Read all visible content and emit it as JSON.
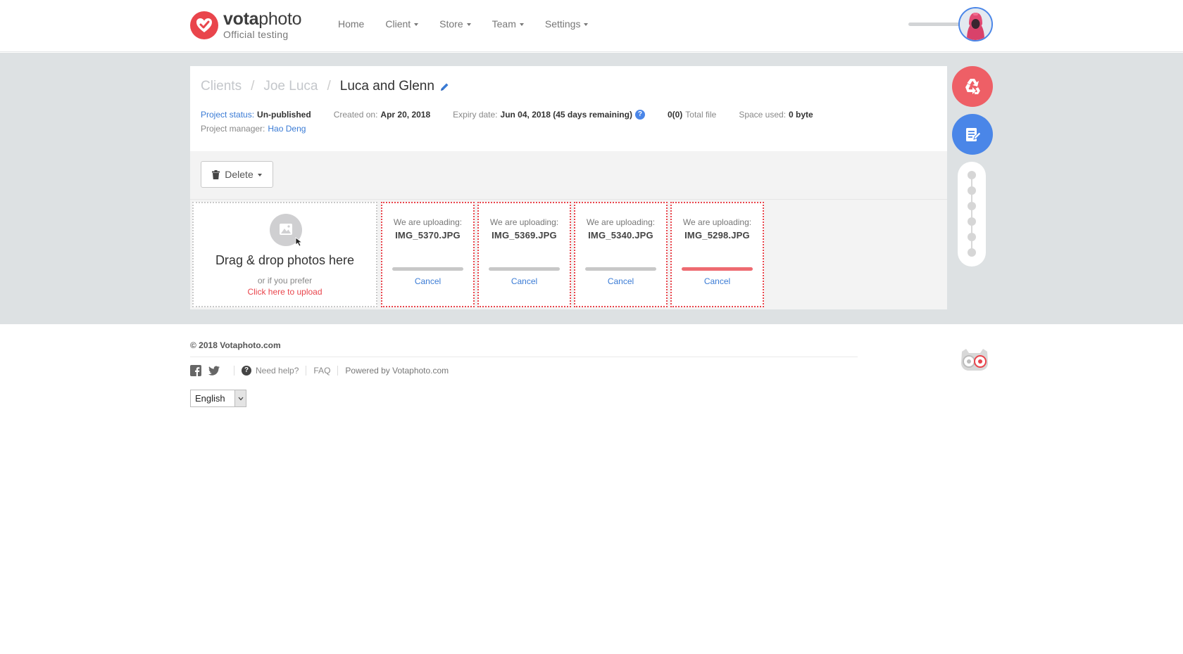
{
  "brand": {
    "name_bold": "vota",
    "name_light": "photo",
    "subtitle": "Official testing",
    "accent": "#e9454c"
  },
  "nav": [
    {
      "label": "Home",
      "dropdown": false
    },
    {
      "label": "Client",
      "dropdown": true
    },
    {
      "label": "Store",
      "dropdown": true
    },
    {
      "label": "Team",
      "dropdown": true
    },
    {
      "label": "Settings",
      "dropdown": true
    }
  ],
  "breadcrumb": {
    "root": "Clients",
    "client": "Joe Luca",
    "project": "Luca and Glenn"
  },
  "meta": {
    "status_label": "Project status:",
    "status_value": "Un-published",
    "created_label": "Created on:",
    "created_value": "Apr 20, 2018",
    "expiry_label": "Expiry date:",
    "expiry_value": "Jun 04, 2018 (45 days remaining)",
    "expiry_help": "?",
    "files_count": "0(0)",
    "files_label": "Total file",
    "space_label": "Space used:",
    "space_value": "0 byte",
    "manager_label": "Project manager:",
    "manager_value": "Hao Deng"
  },
  "toolbar": {
    "delete_label": "Delete"
  },
  "dropzone": {
    "title": "Drag & drop photos here",
    "sub": "or if you prefer",
    "link": "Click here to upload"
  },
  "uploads": [
    {
      "label": "We are uploading:",
      "file": "IMG_5370.JPG",
      "progress": 0,
      "cancel": "Cancel"
    },
    {
      "label": "We are uploading:",
      "file": "IMG_5369.JPG",
      "progress": 0,
      "cancel": "Cancel"
    },
    {
      "label": "We are uploading:",
      "file": "IMG_5340.JPG",
      "progress": 0,
      "cancel": "Cancel"
    },
    {
      "label": "We are uploading:",
      "file": "IMG_5298.JPG",
      "progress": 100,
      "cancel": "Cancel"
    }
  ],
  "footer": {
    "copyright": "© 2018 Votaphoto.com",
    "help": "Need help?",
    "help_icon": "?",
    "faq": "FAQ",
    "powered_prefix": "Powered by",
    "powered_name": "Votaphoto.com",
    "language": "English"
  },
  "colors": {
    "link": "#3a7bd5",
    "red": "#e9454c",
    "blue": "#4a86e8",
    "band": "#dde1e3"
  }
}
